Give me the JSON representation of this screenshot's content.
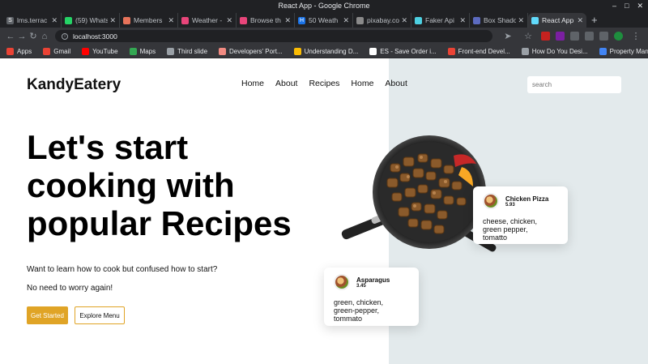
{
  "window": {
    "title": "React App - Google Chrome"
  },
  "tabs": [
    {
      "label": "lms.terrac",
      "color": "#5f6368",
      "glyph": "S"
    },
    {
      "label": "(59) Whats",
      "color": "#25d366",
      "glyph": ""
    },
    {
      "label": "Members",
      "color": "#e8735a",
      "glyph": ""
    },
    {
      "label": "Weather -",
      "color": "#e8457a",
      "glyph": ""
    },
    {
      "label": "Browse th",
      "color": "#e8457a",
      "glyph": ""
    },
    {
      "label": "50 Weath",
      "color": "#1a73e8",
      "glyph": "H"
    },
    {
      "label": "pixabay.co",
      "color": "#8a8a8a",
      "glyph": ""
    },
    {
      "label": "Faker Api",
      "color": "#4dd0e1",
      "glyph": ""
    },
    {
      "label": "Box Shado",
      "color": "#5c6bc0",
      "glyph": ""
    },
    {
      "label": "React App",
      "color": "#61dafb",
      "glyph": "",
      "active": true
    }
  ],
  "address": {
    "url": "localhost:3000"
  },
  "bookmarks": [
    {
      "label": "Apps",
      "color": "#ea4335"
    },
    {
      "label": "Gmail",
      "color": "#ea4335"
    },
    {
      "label": "YouTube",
      "color": "#ff0000"
    },
    {
      "label": "Maps",
      "color": "#34a853"
    },
    {
      "label": "Third slide",
      "color": "#9aa0a6"
    },
    {
      "label": "Developers' Port...",
      "color": "#f28b82"
    },
    {
      "label": "Understanding D...",
      "color": "#fbbc04"
    },
    {
      "label": "ES - Save Order i...",
      "color": "#ffffff"
    },
    {
      "label": "Front-end Devel...",
      "color": "#ea4335"
    },
    {
      "label": "How Do You Desi...",
      "color": "#9aa0a6"
    },
    {
      "label": "Property Manag...",
      "color": "#4285f4"
    }
  ],
  "site": {
    "brand": "KandyEatery",
    "nav": [
      "Home",
      "About",
      "Recipes",
      "Home",
      "About"
    ],
    "search_placeholder": "search",
    "hero": [
      "Let's start",
      "cooking with",
      "popular Recipes"
    ],
    "subtitle1": "Want to learn how to cook but confused how to start?",
    "subtitle2": "No need to worry again!",
    "cta_primary": "Get Started",
    "cta_secondary": "Explore Menu",
    "colors": {
      "accent": "#e0a426",
      "panel": "#e3eaec"
    }
  },
  "cards": {
    "pizza": {
      "title": "Chicken Pizza",
      "price": "5.93",
      "ingredients": [
        "cheese, chicken,",
        "green pepper,",
        "tomatto"
      ]
    },
    "asparagus": {
      "title": "Asparagus",
      "price": "3.45",
      "ingredients": [
        "green, chicken,",
        "green-pepper,",
        "tommato"
      ]
    }
  }
}
